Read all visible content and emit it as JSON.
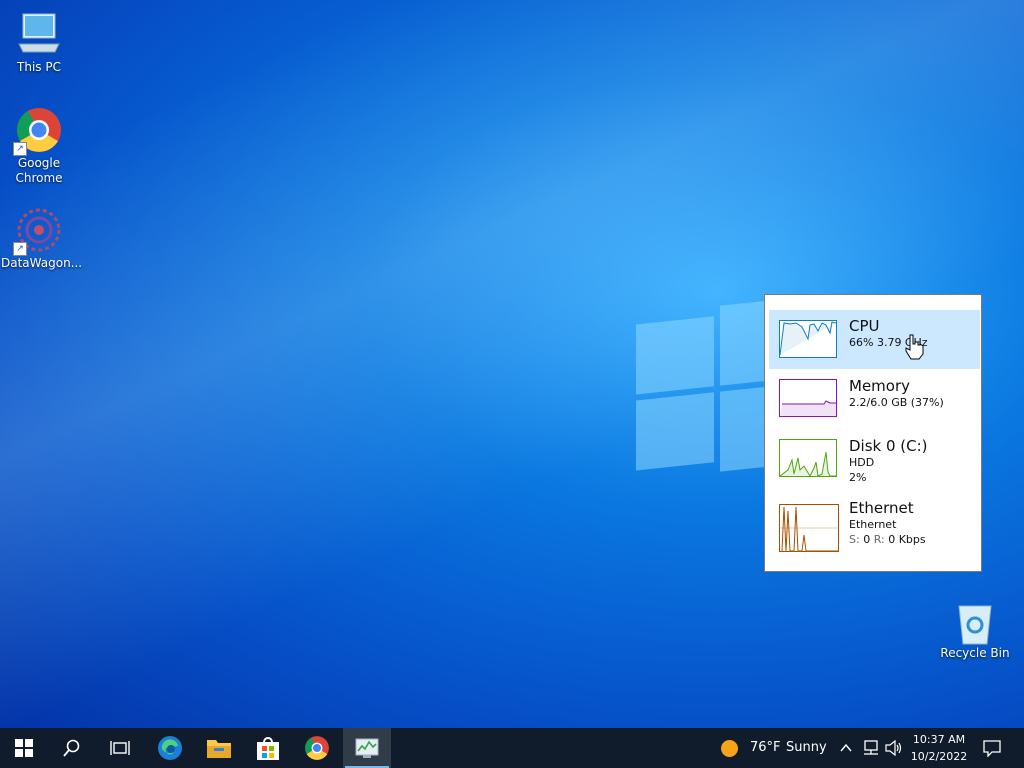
{
  "desktop": {
    "icons": [
      {
        "label": "This PC",
        "icon": "computer-icon"
      },
      {
        "label": "Google\nChrome",
        "icon": "chrome-icon"
      },
      {
        "label": "DataWagon...",
        "icon": "datawagon-icon"
      },
      {
        "label": "Recycle Bin",
        "icon": "recycle-bin-icon"
      }
    ]
  },
  "flyout": {
    "items": [
      {
        "name": "CPU",
        "line1": "66%  3.79 GHz",
        "color": "#117dbb",
        "selected": true
      },
      {
        "name": "Memory",
        "line1": "2.2/6.0 GB (37%)",
        "color": "#8b12ae"
      },
      {
        "name": "Disk 0 (C:)",
        "line1": "HDD",
        "line2": "2%",
        "color": "#4da60c"
      },
      {
        "name": "Ethernet",
        "line1": "Ethernet",
        "line2_prefix_s": "S:",
        "line2_s_val": "0",
        "line2_prefix_r": "R:",
        "line2_r_val": "0 Kbps",
        "color": "#a74f01"
      }
    ]
  },
  "taskbar": {
    "buttons": [
      "start-icon",
      "search-icon",
      "task-view-icon",
      "edge-icon",
      "file-explorer-icon",
      "store-icon",
      "chrome-icon",
      "task-manager-icon"
    ],
    "weather": {
      "temp": "76°F",
      "condition": "Sunny"
    },
    "clock": {
      "time": "10:37 AM",
      "date": "10/2/2022"
    }
  }
}
